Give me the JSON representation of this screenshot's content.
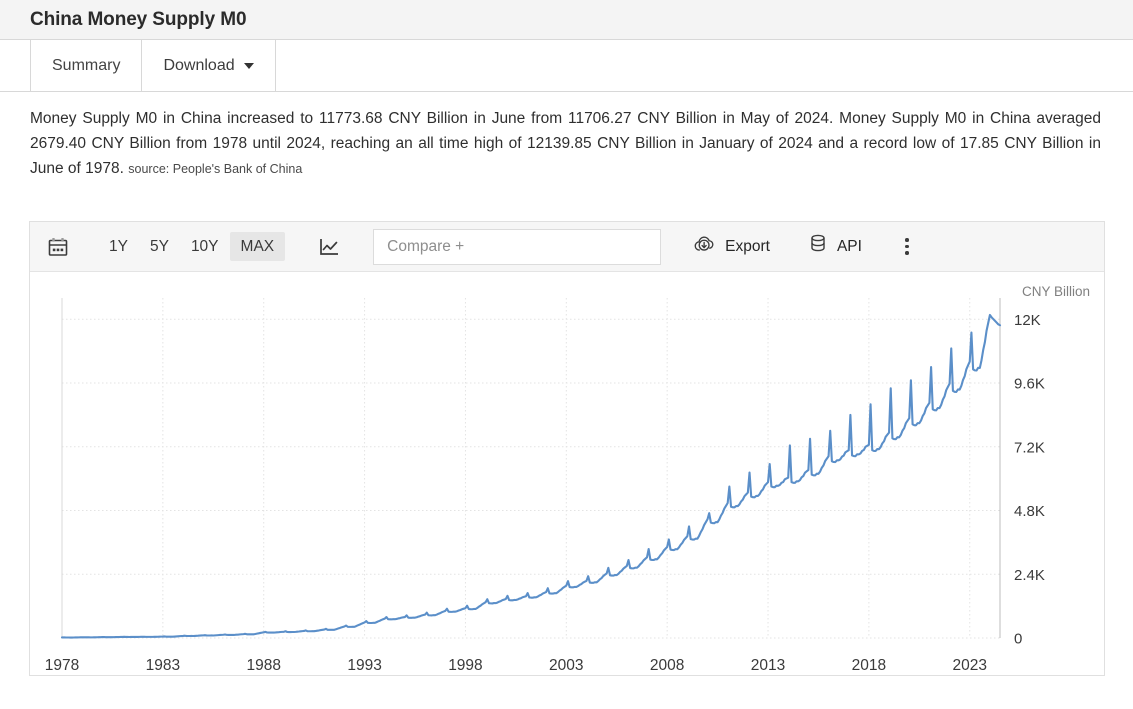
{
  "header": {
    "title": "China Money Supply M0"
  },
  "tabs": [
    {
      "label": "Summary",
      "active": true
    },
    {
      "label": "Download",
      "active": false,
      "has_caret": true
    }
  ],
  "description": {
    "body": "Money Supply M0 in China increased to 11773.68 CNY Billion in June from 11706.27 CNY Billion in May of 2024. Money Supply M0 in China averaged 2679.40 CNY Billion from 1978 until 2024, reaching an all time high of 12139.85 CNY Billion in January of 2024 and a record low of 17.85 CNY Billion in June of 1978.",
    "source": "source: People's Bank of China"
  },
  "toolbar": {
    "calendar_icon": "calendar-icon",
    "ranges": [
      {
        "label": "1Y",
        "active": false
      },
      {
        "label": "5Y",
        "active": false
      },
      {
        "label": "10Y",
        "active": false
      },
      {
        "label": "MAX",
        "active": true
      }
    ],
    "chart_type_icon": "line-chart-icon",
    "compare_placeholder": "Compare +",
    "compare_value": "",
    "export_label": "Export",
    "export_icon": "cloud-download-icon",
    "api_label": "API",
    "api_icon": "database-icon",
    "more_icon": "kebab-menu-icon"
  },
  "colors": {
    "line": "#5b8fc9",
    "grid": "#e3e3e3",
    "axis": "#d9d9d9",
    "toolbar_bg": "#f6f6f6",
    "header_bg": "#f4f4f4",
    "active_range_bg": "#e6e6e6",
    "text": "#2f2f2f"
  },
  "chart_data": {
    "type": "line",
    "title": "China Money Supply M0",
    "unit_label": "CNY Billion",
    "xlabel": "",
    "ylabel": "CNY Billion",
    "xlim": [
      1978.0,
      2024.5
    ],
    "ylim": [
      0,
      12800
    ],
    "yticks": [
      0,
      2400,
      4800,
      7200,
      9600,
      12000
    ],
    "ytick_labels": [
      "0",
      "2.4K",
      "4.8K",
      "7.2K",
      "9.6K",
      "12K"
    ],
    "xticks": [
      1978,
      1983,
      1988,
      1993,
      1998,
      2003,
      2008,
      2013,
      2018,
      2023
    ],
    "xtick_labels": [
      "1978",
      "1983",
      "1988",
      "1993",
      "1998",
      "2003",
      "2008",
      "2013",
      "2018",
      "2023"
    ],
    "grid": true,
    "legend": false,
    "annotations": {
      "latest_value": 11773.68,
      "latest_period": "June 2024",
      "previous_value": 11706.27,
      "previous_period": "May 2024",
      "average": 2679.4,
      "all_time_high": 12139.85,
      "all_time_high_period": "January 2024",
      "record_low": 17.85,
      "record_low_period": "June 1978"
    },
    "series": [
      {
        "name": "Money Supply M0",
        "color": "#5b8fc9",
        "x": [
          1978.0,
          1978.5,
          1979.0,
          1979.5,
          1980.0,
          1980.5,
          1981.0,
          1981.5,
          1982.0,
          1982.5,
          1983.0,
          1983.5,
          1984.0,
          1984.5,
          1985.0,
          1985.5,
          1986.0,
          1986.5,
          1987.0,
          1987.5,
          1988.0,
          1988.5,
          1989.0,
          1989.5,
          1990.0,
          1990.5,
          1991.0,
          1991.5,
          1992.0,
          1992.5,
          1993.0,
          1993.5,
          1994.0,
          1994.5,
          1995.0,
          1995.5,
          1996.0,
          1996.5,
          1997.0,
          1997.5,
          1998.0,
          1998.5,
          1999.0,
          1999.5,
          2000.0,
          2000.5,
          2001.0,
          2001.5,
          2002.0,
          2002.5,
          2003.0,
          2003.5,
          2004.0,
          2004.5,
          2005.0,
          2005.5,
          2006.0,
          2006.5,
          2007.0,
          2007.5,
          2008.0,
          2008.5,
          2009.0,
          2009.5,
          2010.0,
          2010.5,
          2011.0,
          2011.5,
          2012.0,
          2012.5,
          2013.0,
          2013.5,
          2014.0,
          2014.5,
          2015.0,
          2015.5,
          2016.0,
          2016.5,
          2017.0,
          2017.5,
          2018.0,
          2018.5,
          2019.0,
          2019.5,
          2020.0,
          2020.5,
          2021.0,
          2021.5,
          2022.0,
          2022.5,
          2023.0,
          2023.5,
          2024.0,
          2024.46
        ],
        "y": [
          21,
          17.85,
          26,
          24,
          34,
          32,
          40,
          39,
          44,
          43,
          53,
          52,
          79,
          77,
          99,
          96,
          122,
          119,
          145,
          142,
          213,
          210,
          234,
          230,
          264,
          260,
          318,
          315,
          433,
          430,
          586,
          580,
          728,
          720,
          788,
          780,
          880,
          875,
          1018,
          1010,
          1120,
          1112,
          1346,
          1338,
          1465,
          1458,
          1569,
          1560,
          1727,
          1718,
          1970,
          1960,
          2146,
          2135,
          2427,
          2415,
          2707,
          2695,
          3033,
          3020,
          3421,
          3405,
          3824,
          3810,
          4462,
          4445,
          5074,
          5060,
          5466,
          5450,
          5857,
          5840,
          6026,
          6010,
          6314,
          6300,
          6830,
          6815,
          7059,
          7045,
          7260,
          7245,
          7720,
          7700,
          8260,
          8240,
          8840,
          8820,
          9560,
          9530,
          10390,
          10360,
          12139.85,
          11773.68
        ],
        "peaks": [
          {
            "year": 1999.08,
            "value": 1460
          },
          {
            "year": 2001.08,
            "value": 1690
          },
          {
            "year": 2003.08,
            "value": 2140
          },
          {
            "year": 2005.08,
            "value": 2640
          },
          {
            "year": 2007.08,
            "value": 3350
          },
          {
            "year": 2009.08,
            "value": 4200
          },
          {
            "year": 2010.08,
            "value": 4700
          },
          {
            "year": 2011.08,
            "value": 5700
          },
          {
            "year": 2012.08,
            "value": 6230
          },
          {
            "year": 2013.08,
            "value": 6550
          },
          {
            "year": 2014.08,
            "value": 7250
          },
          {
            "year": 2015.08,
            "value": 7500
          },
          {
            "year": 2016.08,
            "value": 7800
          },
          {
            "year": 2017.08,
            "value": 8400
          },
          {
            "year": 2018.08,
            "value": 8800
          },
          {
            "year": 2019.08,
            "value": 9400
          },
          {
            "year": 2020.08,
            "value": 9700
          },
          {
            "year": 2021.08,
            "value": 10200
          },
          {
            "year": 2022.08,
            "value": 10900
          },
          {
            "year": 2023.08,
            "value": 11500
          },
          {
            "year": 2024.08,
            "value": 12139.85
          }
        ]
      }
    ]
  }
}
